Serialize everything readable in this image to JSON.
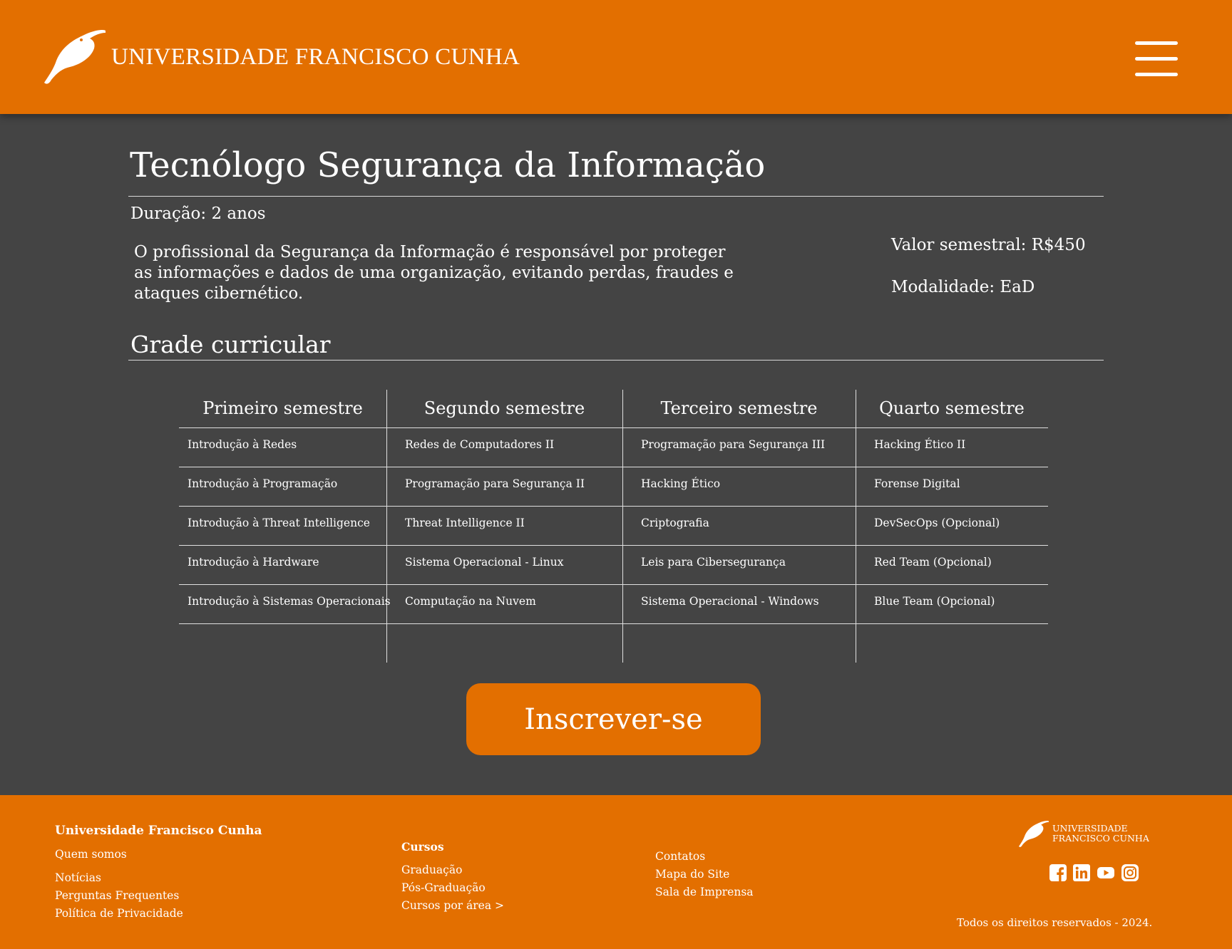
{
  "header": {
    "brand": "UNIVERSIDADE FRANCISCO CUNHA",
    "logo_icon": "toucan-logo-icon",
    "menu_icon": "hamburger-menu-icon"
  },
  "course": {
    "title": "Tecnólogo Segurança da Informação",
    "duration": "Duração: 2 anos",
    "description": "O profissional da Segurança da Informação é responsável por proteger as informações e dados de uma organização, evitando perdas, fraudes e ataques cibernético.",
    "price": "Valor semestral: R$450",
    "modality": "Modalidade: EaD"
  },
  "curriculum": {
    "title": "Grade curricular",
    "columns": [
      "Primeiro semestre",
      "Segundo semestre",
      "Terceiro semestre",
      "Quarto semestre"
    ],
    "rows": [
      [
        "Introdução à Redes",
        "Redes de Computadores II",
        "Programação para Segurança III",
        "Hacking Ético II"
      ],
      [
        "Introdução à Programação",
        "Programação para Segurança II",
        "Hacking Ético",
        "Forense Digital"
      ],
      [
        "Introdução à Threat Intelligence",
        "Threat Intelligence II",
        "Criptografia",
        "DevSecOps (Opcional)"
      ],
      [
        "Introdução à Hardware",
        "Sistema Operacional - Linux",
        "Leis para Cibersegurança",
        "Red Team (Opcional)"
      ],
      [
        "Introdução à Sistemas Operacionais",
        "Computação na Nuvem",
        "Sistema Operacional - Windows",
        "Blue Team (Opcional)"
      ]
    ]
  },
  "cta": {
    "label": "Inscrever-se"
  },
  "footer": {
    "col1": {
      "title": "Universidade Francisco Cunha",
      "links": [
        "Quem somos",
        "Notícias",
        "Perguntas Frequentes",
        "Política de Privacidade"
      ]
    },
    "col2": {
      "title": "Cursos",
      "links": [
        "Graduação",
        "Pós-Graduação",
        "Cursos por área >"
      ]
    },
    "col3": {
      "links": [
        "Contatos",
        "Mapa do Site",
        "Sala de Imprensa"
      ]
    },
    "brand_line1": "UNIVERSIDADE",
    "brand_line2": "FRANCISCO CUNHA",
    "social_icons": [
      "facebook-icon",
      "linkedin-icon",
      "youtube-icon",
      "instagram-icon"
    ],
    "copyright": "Todos os direitos reservados - 2024."
  },
  "colors": {
    "accent": "#e36f00",
    "background": "#444444",
    "text": "#ffffff"
  }
}
